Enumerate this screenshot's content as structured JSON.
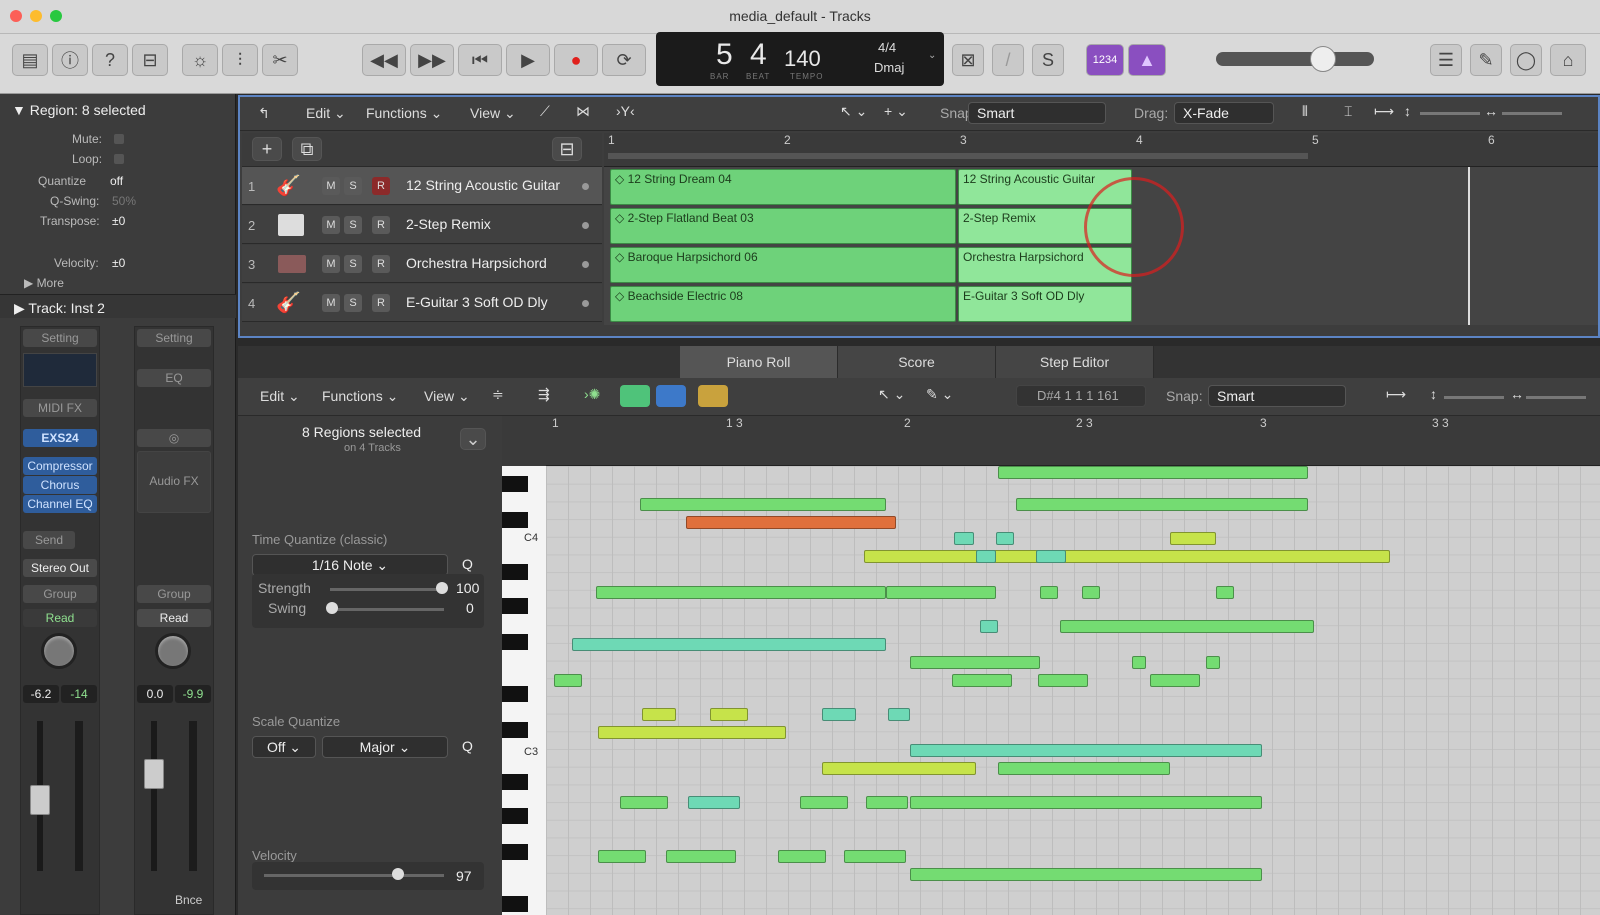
{
  "window": {
    "title": "media_default - Tracks"
  },
  "lcd": {
    "bar": "5",
    "beat": "4",
    "bar_label": "BAR",
    "beat_label": "BEAT",
    "tempo": "140",
    "tempo_label": "TEMPO",
    "signature": "4/4",
    "key": "Dmaj"
  },
  "toolbar": {
    "counter": "1234"
  },
  "inspector": {
    "region_header": "Region: 8 selected",
    "mute_label": "Mute:",
    "loop_label": "Loop:",
    "quantize_label": "Quantize",
    "quantize_value": "off",
    "qswing_label": "Q-Swing:",
    "qswing_value": "50%",
    "transpose_label": "Transpose:",
    "transpose_value": "±0",
    "velocity_label": "Velocity:",
    "velocity_value": "±0",
    "more_label": "More",
    "track_header": "Track:  Inst 2"
  },
  "channel1": {
    "setting": "Setting",
    "midi_fx": "MIDI FX",
    "instrument": "EXS24",
    "fx": [
      "Compressor",
      "Chorus",
      "Channel EQ"
    ],
    "send": "Send",
    "output": "Stereo Out",
    "group": "Group",
    "automation": "Read",
    "pan_value": "-6.2",
    "level_value": "-14"
  },
  "channel2": {
    "setting": "Setting",
    "eq": "EQ",
    "audio_fx": "Audio FX",
    "group": "Group",
    "automation": "Read",
    "pan_value": "0.0",
    "level_value": "-9.9",
    "name": "Bnce"
  },
  "tracks_menu": {
    "edit": "Edit",
    "functions": "Functions",
    "view": "View",
    "snap_label": "Snap:",
    "snap_value": "Smart",
    "drag_label": "Drag:",
    "drag_value": "X-Fade"
  },
  "tracks_ruler": [
    "1",
    "2",
    "3",
    "4",
    "5",
    "6"
  ],
  "tracks": [
    {
      "num": "1",
      "name": "12 String Acoustic Guitar",
      "region_a": "12 String Dream 04",
      "region_b": "12 String Acoustic Guitar",
      "m": "M",
      "s": "S",
      "r": "R"
    },
    {
      "num": "2",
      "name": "2-Step Remix",
      "region_a": "2-Step Flatland Beat 03",
      "region_b": "2-Step Remix",
      "m": "M",
      "s": "S",
      "r": "R"
    },
    {
      "num": "3",
      "name": "Orchestra Harpsichord",
      "region_a": "Baroque Harpsichord 06",
      "region_b": "Orchestra Harpsichord",
      "m": "M",
      "s": "S",
      "r": "R"
    },
    {
      "num": "4",
      "name": "E-Guitar 3 Soft OD Dly",
      "region_a": "Beachside Electric 08",
      "region_b": "E-Guitar 3 Soft OD Dly",
      "m": "M",
      "s": "S",
      "r": "R"
    }
  ],
  "editor_tabs": [
    "Piano Roll",
    "Score",
    "Step Editor"
  ],
  "piano_menu": {
    "edit": "Edit",
    "functions": "Functions",
    "view": "View",
    "position": "D#4  1 1 1 161",
    "snap_label": "Snap:",
    "snap_value": "Smart"
  },
  "piano_ruler": [
    "1",
    "1 3",
    "2",
    "2 3",
    "3",
    "3 3"
  ],
  "piano_left": {
    "regions_selected": "8 Regions selected",
    "on_tracks": "on 4 Tracks",
    "time_quantize_label": "Time Quantize (classic)",
    "time_quantize_value": "1/16 Note",
    "q": "Q",
    "strength_label": "Strength",
    "strength_value": "100",
    "swing_label": "Swing",
    "swing_value": "0",
    "scale_quantize_label": "Scale Quantize",
    "scale_off": "Off",
    "scale_major": "Major",
    "velocity_label": "Velocity",
    "velocity_value": "97"
  },
  "key_labels": {
    "c4": "C4",
    "c3": "C3"
  }
}
